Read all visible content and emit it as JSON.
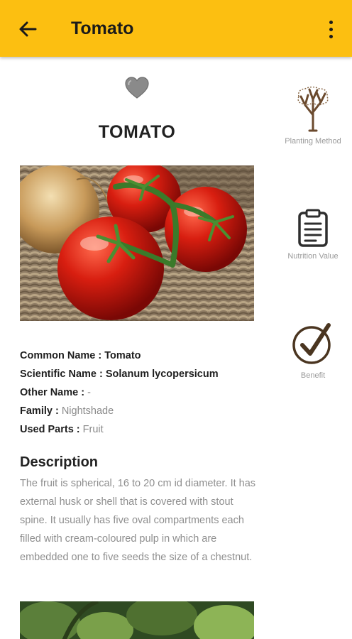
{
  "app_bar": {
    "title": "Tomato",
    "back_icon": "arrow-left-icon",
    "menu_icon": "more-vert-icon",
    "color": "#fcbf11"
  },
  "favorite": {
    "icon": "heart-icon",
    "color": "#888888"
  },
  "plant": {
    "heading": "TOMATO",
    "image": "tomato-photo",
    "details": [
      {
        "key": "Common Name : ",
        "value": "Tomato"
      },
      {
        "key": "Scientific Name : ",
        "value": "Solanum lycopersicum"
      },
      {
        "key": "Other Name : ",
        "value": "-"
      },
      {
        "key": "Family : ",
        "value": "Nightshade"
      },
      {
        "key": "Used Parts : ",
        "value": "Fruit"
      }
    ]
  },
  "description": {
    "title": "Description",
    "body": "The fruit is spherical, 16 to 20 cm id diameter. It has external husk or shell that is covered with stout spine. It usually has five oval compartments each filled with cream-coloured pulp in which are embedded one to five seeds the size of a chestnut."
  },
  "side_menu": [
    {
      "label": "Planting Method",
      "icon": "tree-icon"
    },
    {
      "label": "Nutrition Value",
      "icon": "clipboard-icon"
    },
    {
      "label": "Benefit",
      "icon": "checkmark-circle-icon"
    }
  ]
}
